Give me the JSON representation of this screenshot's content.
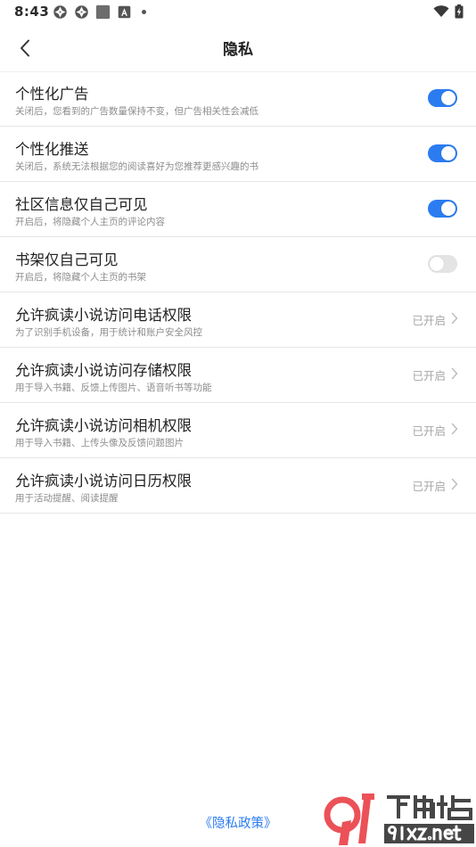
{
  "status_bar": {
    "time": "8:43"
  },
  "header": {
    "title": "隐私"
  },
  "settings": [
    {
      "title": "个性化广告",
      "subtitle": "关闭后，您看到的广告数量保持不变，但广告相关性会减低",
      "type": "toggle",
      "enabled": true
    },
    {
      "title": "个性化推送",
      "subtitle": "关闭后，系统无法根据您的阅读喜好为您推荐更感兴趣的书",
      "type": "toggle",
      "enabled": true
    },
    {
      "title": "社区信息仅自己可见",
      "subtitle": "开启后，将隐藏个人主页的评论内容",
      "type": "toggle",
      "enabled": true
    },
    {
      "title": "书架仅自己可见",
      "subtitle": "开启后，将隐藏个人主页的书架",
      "type": "toggle",
      "enabled": false
    },
    {
      "title": "允许疯读小说访问电话权限",
      "subtitle": "为了识别手机设备，用于统计和账户安全风控",
      "type": "link",
      "status": "已开启"
    },
    {
      "title": "允许疯读小说访问存储权限",
      "subtitle": "用于导入书籍、反馈上传图片、语音听书等功能",
      "type": "link",
      "status": "已开启"
    },
    {
      "title": "允许疯读小说访问相机权限",
      "subtitle": "用于导入书籍、上传头像及反馈问题图片",
      "type": "link",
      "status": "已开启"
    },
    {
      "title": "允许疯读小说访问日历权限",
      "subtitle": "用于活动提醒、阅读提醒",
      "type": "link",
      "status": "已开启"
    }
  ],
  "footer": {
    "policy_link": "《隐私政策》"
  },
  "watermark": {
    "brand": "下载站",
    "domain": "91xz.net"
  },
  "colors": {
    "accent": "#2b7cf0",
    "toggle_off": "#e4e4e4",
    "watermark_red": "#e8333a"
  },
  "icons": {
    "back": "chevron-left-icon",
    "row_link": "chevron-right-icon"
  }
}
